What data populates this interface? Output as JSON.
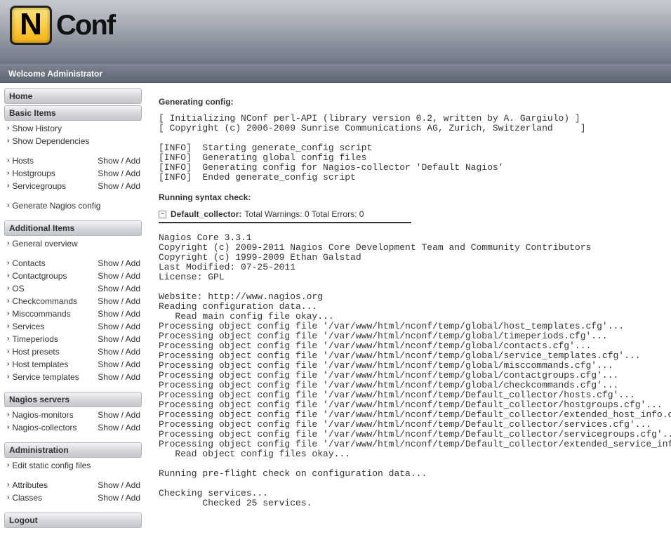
{
  "logo": {
    "n": "N",
    "conf": "Conf"
  },
  "welcome": "Welcome Administrator",
  "action": {
    "show": "Show",
    "add": "Add",
    "sep": " / "
  },
  "sidebar": {
    "home": "Home",
    "basic": {
      "header": "Basic Items",
      "history": "Show History",
      "dependencies": "Show Dependencies",
      "hosts": "Hosts",
      "hostgroups": "Hostgroups",
      "servicegroups": "Servicegroups",
      "generate": "Generate Nagios config"
    },
    "additional": {
      "header": "Additional Items",
      "overview": "General overview",
      "contacts": "Contacts",
      "contactgroups": "Contactgroups",
      "os": "OS",
      "checkcommands": "Checkcommands",
      "misccommands": "Misccommands",
      "services": "Services",
      "timeperiods": "Timeperiods",
      "hostpresets": "Host presets",
      "hosttemplates": "Host templates",
      "servicetemplates": "Service templates"
    },
    "nagios": {
      "header": "Nagios servers",
      "monitors": "Nagios-monitors",
      "collectors": "Nagios-collectors"
    },
    "admin": {
      "header": "Administration",
      "editstatic": "Edit static config files",
      "attributes": "Attributes",
      "classes": "Classes"
    },
    "logout": "Logout"
  },
  "main": {
    "genHeading": "Generating config:",
    "genOutput": "[ Initializing NConf perl-API (library version 0.2, written by A. Gargiulo) ]\n[ Copyright (c) 2006-2009 Sunrise Communications AG, Zurich, Switzerland     ]\n\n[INFO]  Starting generate_config script\n[INFO]  Generating global config files\n[INFO]  Generating config for Nagios-collector 'Default Nagios'\n[INFO]  Ended generate_config script",
    "syntaxHeading": "Running syntax check:",
    "collector": {
      "name": "Default_collector:",
      "summary": "Total Warnings: 0  Total Errors: 0"
    },
    "syntaxOutput": "Nagios Core 3.3.1\nCopyright (c) 2009-2011 Nagios Core Development Team and Community Contributors\nCopyright (c) 1999-2009 Ethan Galstad\nLast Modified: 07-25-2011\nLicense: GPL\n\nWebsite: http://www.nagios.org\nReading configuration data...\n   Read main config file okay...\nProcessing object config file '/var/www/html/nconf/temp/global/host_templates.cfg'...\nProcessing object config file '/var/www/html/nconf/temp/global/timeperiods.cfg'...\nProcessing object config file '/var/www/html/nconf/temp/global/contacts.cfg'...\nProcessing object config file '/var/www/html/nconf/temp/global/service_templates.cfg'...\nProcessing object config file '/var/www/html/nconf/temp/global/misccommands.cfg'...\nProcessing object config file '/var/www/html/nconf/temp/global/contactgroups.cfg'...\nProcessing object config file '/var/www/html/nconf/temp/global/checkcommands.cfg'...\nProcessing object config file '/var/www/html/nconf/temp/Default_collector/hosts.cfg'...\nProcessing object config file '/var/www/html/nconf/temp/Default_collector/hostgroups.cfg'...\nProcessing object config file '/var/www/html/nconf/temp/Default_collector/extended_host_info.cfg'...\nProcessing object config file '/var/www/html/nconf/temp/Default_collector/services.cfg'...\nProcessing object config file '/var/www/html/nconf/temp/Default_collector/servicegroups.cfg'...\nProcessing object config file '/var/www/html/nconf/temp/Default_collector/extended_service_info.cfg'...\n   Read object config files okay...\n\nRunning pre-flight check on configuration data...\n\nChecking services...\n        Checked 25 services."
  }
}
